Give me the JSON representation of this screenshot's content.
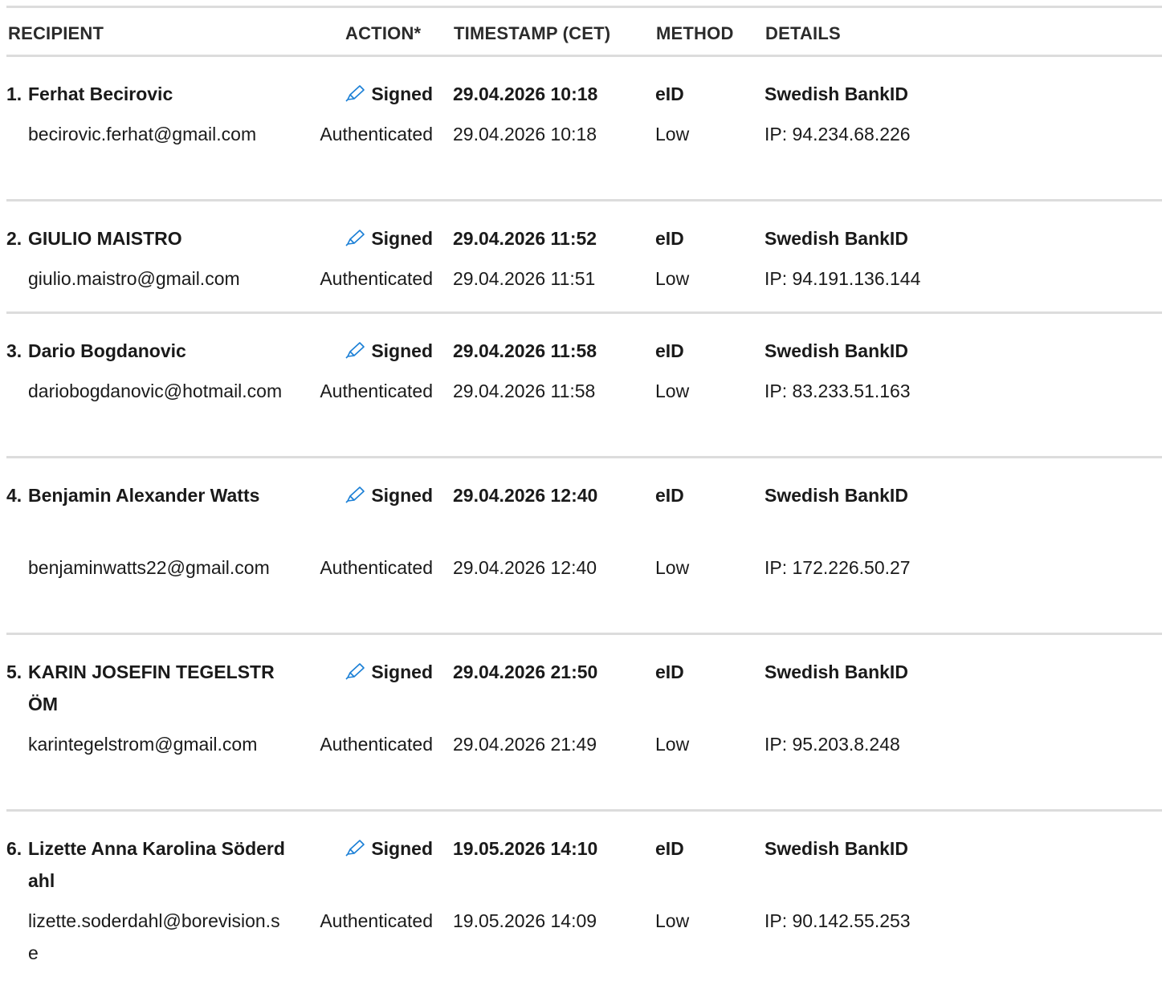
{
  "header": {
    "recipient": "RECIPIENT",
    "action": "ACTION*",
    "timestamp": "TIMESTAMP (CET)",
    "method": "METHOD",
    "details": "DETAILS"
  },
  "colors": {
    "pen_icon": "#1a7fd6",
    "divider": "#dcdcdc"
  },
  "icons": {
    "signed": "pen-icon"
  },
  "rows": [
    {
      "num": "1.",
      "name": "Ferhat Becirovic",
      "email": "becirovic.ferhat@gmail.com",
      "signed": "Signed",
      "signed_ts": "29.04.2026 10:18",
      "signed_method": "eID",
      "signed_details": "Swedish BankID",
      "auth": "Authenticated",
      "auth_ts": "29.04.2026 10:18",
      "auth_method": "Low",
      "auth_details": "IP: 94.234.68.226"
    },
    {
      "num": "2.",
      "name": "GIULIO MAISTRO",
      "email": "giulio.maistro@gmail.com",
      "signed": "Signed",
      "signed_ts": "29.04.2026 11:52",
      "signed_method": "eID",
      "signed_details": "Swedish BankID",
      "auth": "Authenticated",
      "auth_ts": "29.04.2026 11:51",
      "auth_method": "Low",
      "auth_details": "IP: 94.191.136.144"
    },
    {
      "num": "3.",
      "name": "Dario Bogdanovic",
      "email": "dariobogdanovic@hotmail.com",
      "signed": "Signed",
      "signed_ts": "29.04.2026 11:58",
      "signed_method": "eID",
      "signed_details": "Swedish BankID",
      "auth": "Authenticated",
      "auth_ts": "29.04.2026 11:58",
      "auth_method": "Low",
      "auth_details": "IP: 83.233.51.163"
    },
    {
      "num": "4.",
      "name": "Benjamin Alexander Watts",
      "email": "benjaminwatts22@gmail.com",
      "signed": "Signed",
      "signed_ts": "29.04.2026 12:40",
      "signed_method": "eID",
      "signed_details": "Swedish BankID",
      "auth": "Authenticated",
      "auth_ts": "29.04.2026 12:40",
      "auth_method": "Low",
      "auth_details": "IP: 172.226.50.27"
    },
    {
      "num": "5.",
      "name": "KARIN JOSEFIN TEGELSTRÖM",
      "email": "karintegelstrom@gmail.com",
      "signed": "Signed",
      "signed_ts": "29.04.2026 21:50",
      "signed_method": "eID",
      "signed_details": "Swedish BankID",
      "auth": "Authenticated",
      "auth_ts": "29.04.2026 21:49",
      "auth_method": "Low",
      "auth_details": "IP: 95.203.8.248"
    },
    {
      "num": "6.",
      "name": "Lizette Anna Karolina Söderdahl",
      "email": "lizette.soderdahl@borevision.se",
      "signed": "Signed",
      "signed_ts": "19.05.2026 14:10",
      "signed_method": "eID",
      "signed_details": "Swedish BankID",
      "auth": "Authenticated",
      "auth_ts": "19.05.2026 14:09",
      "auth_method": "Low",
      "auth_details": "IP: 90.142.55.253"
    }
  ]
}
